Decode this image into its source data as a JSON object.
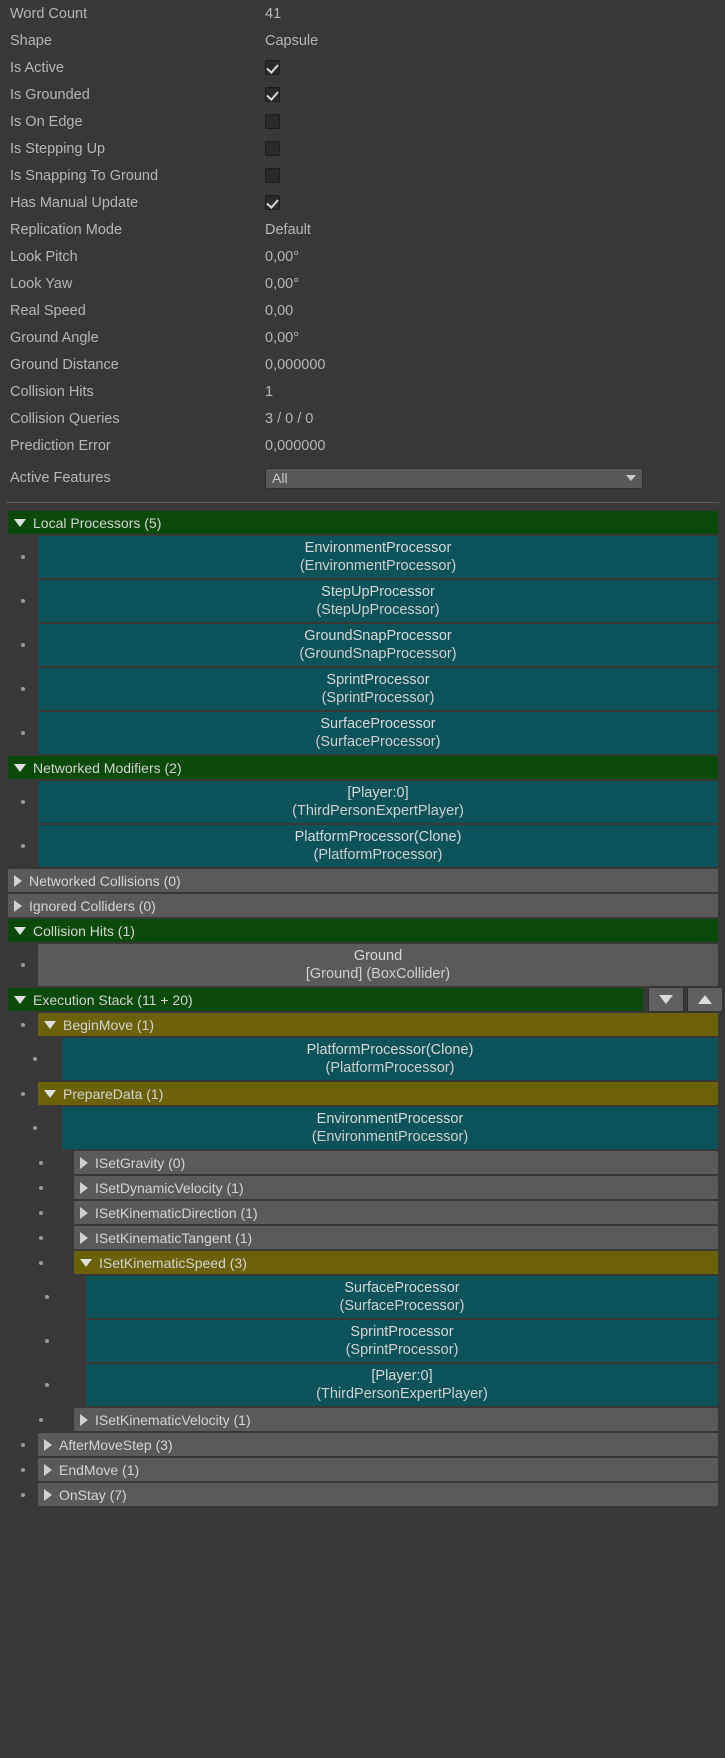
{
  "properties": [
    {
      "label": "Word Count",
      "type": "text",
      "value": "41"
    },
    {
      "label": "Shape",
      "type": "text",
      "value": "Capsule"
    },
    {
      "label": "Is Active",
      "type": "checkbox",
      "checked": true
    },
    {
      "label": "Is Grounded",
      "type": "checkbox",
      "checked": true
    },
    {
      "label": "Is On Edge",
      "type": "checkbox",
      "checked": false
    },
    {
      "label": "Is Stepping Up",
      "type": "checkbox",
      "checked": false
    },
    {
      "label": "Is Snapping To Ground",
      "type": "checkbox",
      "checked": false
    },
    {
      "label": "Has Manual Update",
      "type": "checkbox",
      "checked": true
    },
    {
      "label": "Replication Mode",
      "type": "text",
      "value": "Default"
    },
    {
      "label": "Look Pitch",
      "type": "text",
      "value": "0,00°"
    },
    {
      "label": "Look Yaw",
      "type": "text",
      "value": "0,00°"
    },
    {
      "label": "Real Speed",
      "type": "text",
      "value": "0,00"
    },
    {
      "label": "Ground Angle",
      "type": "text",
      "value": "0,00°"
    },
    {
      "label": "Ground Distance",
      "type": "text",
      "value": "0,000000"
    },
    {
      "label": "Collision Hits",
      "type": "text",
      "value": "1"
    },
    {
      "label": "Collision Queries",
      "type": "text",
      "value": "3 / 0 / 0"
    },
    {
      "label": "Prediction Error",
      "type": "text",
      "value": "0,000000"
    }
  ],
  "active_features": {
    "label": "Active Features",
    "selected": "All",
    "icon": "chevron-down-icon"
  },
  "local_processors": {
    "title": "Local Processors (5)",
    "expanded": true,
    "color": "#0a4a08",
    "items": [
      {
        "name": "EnvironmentProcessor",
        "type": "(EnvironmentProcessor)"
      },
      {
        "name": "StepUpProcessor",
        "type": "(StepUpProcessor)"
      },
      {
        "name": "GroundSnapProcessor",
        "type": "(GroundSnapProcessor)"
      },
      {
        "name": "SprintProcessor",
        "type": "(SprintProcessor)"
      },
      {
        "name": "SurfaceProcessor",
        "type": "(SurfaceProcessor)"
      }
    ]
  },
  "networked_modifiers": {
    "title": "Networked Modifiers (2)",
    "expanded": true,
    "items": [
      {
        "name": "[Player:0]",
        "type": "(ThirdPersonExpertPlayer)"
      },
      {
        "name": "PlatformProcessor(Clone)",
        "type": "(PlatformProcessor)"
      }
    ]
  },
  "networked_collisions": {
    "title": "Networked Collisions (0)",
    "expanded": false
  },
  "ignored_colliders": {
    "title": "Ignored Colliders (0)",
    "expanded": false
  },
  "collision_hits": {
    "title": "Collision Hits (1)",
    "expanded": true,
    "items": [
      {
        "name": "Ground",
        "type": "[Ground] (BoxCollider)"
      }
    ]
  },
  "execution_stack": {
    "title": "Execution Stack (11 + 20)",
    "expanded": true,
    "nav_down_icon": "triangle-down-icon",
    "nav_up_icon": "triangle-up-icon",
    "nodes": [
      {
        "title": "BeginMove (1)",
        "expanded": true,
        "style": "olive",
        "level": 1,
        "items": [
          {
            "name": "PlatformProcessor(Clone)",
            "type": "(PlatformProcessor)"
          }
        ]
      },
      {
        "title": "PrepareData (1)",
        "expanded": true,
        "style": "olive",
        "level": 1,
        "items": [
          {
            "name": "EnvironmentProcessor",
            "type": "(EnvironmentProcessor)"
          }
        ],
        "children": [
          {
            "title": "ISetGravity (0)",
            "expanded": false,
            "style": "gray",
            "level": 2
          },
          {
            "title": "ISetDynamicVelocity (1)",
            "expanded": false,
            "style": "gray",
            "level": 2
          },
          {
            "title": "ISetKinematicDirection (1)",
            "expanded": false,
            "style": "gray",
            "level": 2
          },
          {
            "title": "ISetKinematicTangent (1)",
            "expanded": false,
            "style": "gray",
            "level": 2
          },
          {
            "title": "ISetKinematicSpeed (3)",
            "expanded": true,
            "style": "olive",
            "level": 2,
            "items": [
              {
                "name": "SurfaceProcessor",
                "type": "(SurfaceProcessor)"
              },
              {
                "name": "SprintProcessor",
                "type": "(SprintProcessor)"
              },
              {
                "name": "[Player:0]",
                "type": "(ThirdPersonExpertPlayer)"
              }
            ]
          },
          {
            "title": "ISetKinematicVelocity (1)",
            "expanded": false,
            "style": "gray",
            "level": 2
          }
        ]
      },
      {
        "title": "AfterMoveStep (3)",
        "expanded": false,
        "style": "gray",
        "level": 1
      },
      {
        "title": "EndMove (1)",
        "expanded": false,
        "style": "gray",
        "level": 1
      },
      {
        "title": "OnStay (7)",
        "expanded": false,
        "style": "gray",
        "level": 1
      }
    ]
  }
}
